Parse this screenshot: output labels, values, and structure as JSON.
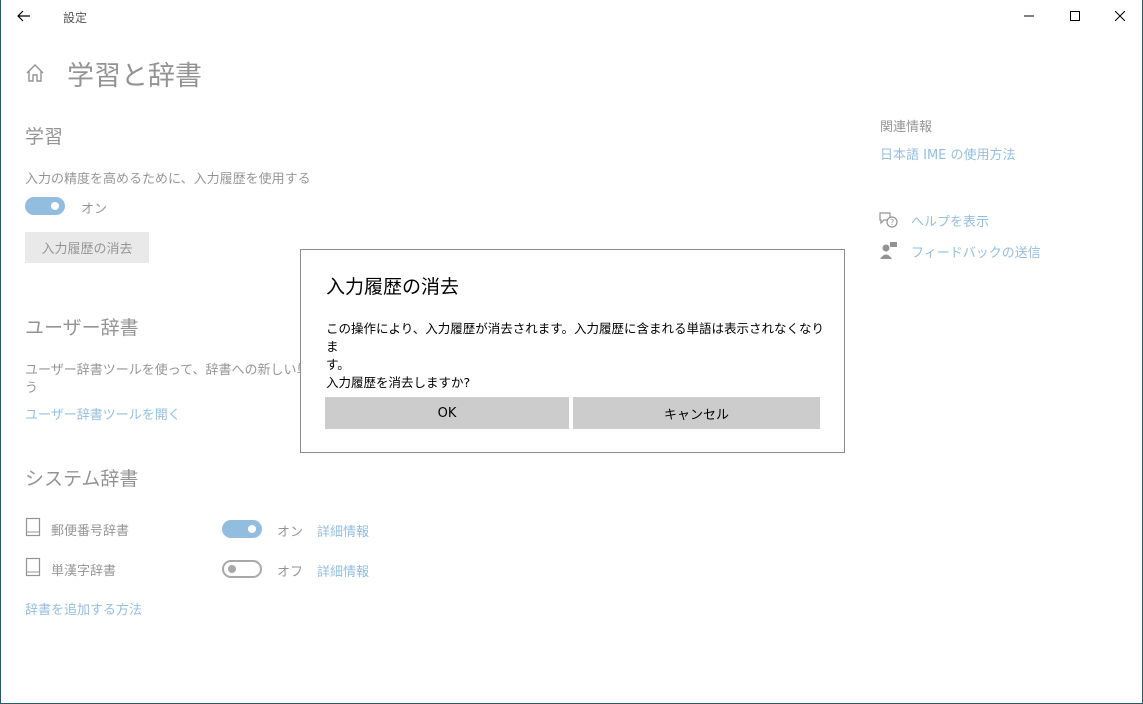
{
  "window": {
    "title": "設定"
  },
  "page": {
    "title": "学習と辞書"
  },
  "learning": {
    "heading": "学習",
    "description": "入力の精度を高めるために、入力履歴を使用する",
    "toggle_state": "オン",
    "clear_button": "入力履歴の消去"
  },
  "user_dict": {
    "heading": "ユーザー辞書",
    "description_line1": "ユーザー辞書ツールを使って、辞書への新しい単語の",
    "description_line2": "う",
    "open_link": "ユーザー辞書ツールを開く"
  },
  "system_dict": {
    "heading": "システム辞書",
    "items": [
      {
        "name": "郵便番号辞書",
        "state": "オン",
        "details": "詳細情報"
      },
      {
        "name": "単漢字辞書",
        "state": "オフ",
        "details": "詳細情報"
      }
    ],
    "add_link": "辞書を追加する方法"
  },
  "related": {
    "heading": "関連情報",
    "link": "日本語 IME の使用方法",
    "help": "ヘルプを表示",
    "feedback": "フィードバックの送信"
  },
  "dialog": {
    "title": "入力履歴の消去",
    "message_line1": "この操作により、入力履歴が消去されます。入力履歴に含まれる単語は表示されなくなりま",
    "message_line2": "す。",
    "message_line3": "入力履歴を消去しますか?",
    "ok": "OK",
    "cancel": "キャンセル"
  },
  "colors": {
    "accent": "#0063b1",
    "button_gray": "#cccccc"
  }
}
